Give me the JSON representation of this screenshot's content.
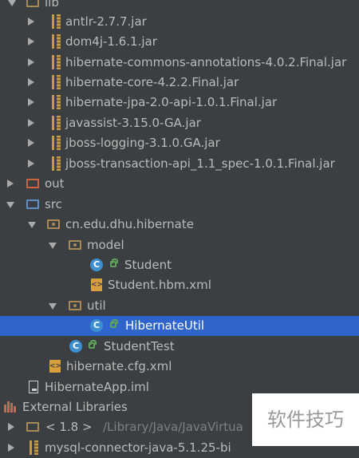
{
  "tree": {
    "lib_label": "lib",
    "jars": [
      "antlr-2.7.7.jar",
      "dom4j-1.6.1.jar",
      "hibernate-commons-annotations-4.0.2.Final.jar",
      "hibernate-core-4.2.2.Final.jar",
      "hibernate-jpa-2.0-api-1.0.1.Final.jar",
      "javassist-3.15.0-GA.jar",
      "jboss-logging-3.1.0.GA.jar",
      "jboss-transaction-api_1.1_spec-1.0.1.Final.jar"
    ],
    "out_label": "out",
    "src_label": "src",
    "package_label": "cn.edu.dhu.hibernate",
    "model_label": "model",
    "student_class": "Student",
    "student_hbm": "Student.hbm.xml",
    "util_label": "util",
    "hibernate_util": "HibernateUtil",
    "student_test": "StudentTest",
    "cfg_xml": "hibernate.cfg.xml",
    "iml_file": "HibernateApp.iml",
    "external_libraries": "External Libraries",
    "jdk_label": "< 1.8 >",
    "jdk_path": "/Library/Java/JavaVirtua",
    "mysql_label": "mysql-connector-java-5.1.25-bi"
  },
  "class_icon_letter": "C",
  "xml_icon_text": "<>",
  "watermark_text": "软件技巧",
  "colors": {
    "background": "#3c3f41",
    "selection": "#2f65ca",
    "text": "#bbbbbb"
  },
  "selected_item": "HibernateUtil"
}
